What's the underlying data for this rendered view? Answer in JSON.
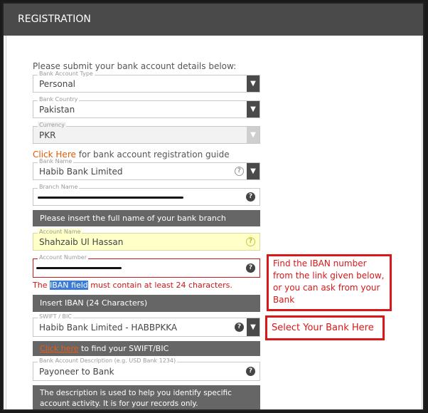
{
  "header": {
    "title": "REGISTRATION"
  },
  "intro": "Please submit your bank account details below:",
  "fields": {
    "account_type": {
      "label": "Bank Account Type",
      "value": "Personal"
    },
    "bank_country": {
      "label": "Bank Country",
      "value": "Pakistan"
    },
    "currency": {
      "label": "Currency",
      "value": "PKR"
    },
    "bank_name": {
      "label": "Bank Name",
      "value": "Habib Bank Limited"
    },
    "branch_name": {
      "label": "Branch Name",
      "value": ""
    },
    "account_name": {
      "label": "Account Name",
      "value": "Shahzaib Ul Hassan"
    },
    "account_number": {
      "label": "Account Number",
      "value": ""
    },
    "swift": {
      "label": "SWIFT / BIC",
      "value": "Habib Bank Limited - HABBPKKA"
    },
    "description": {
      "label": "Bank Account Description (e.g. USD Bank 1234)",
      "value": "Payoneer to Bank"
    }
  },
  "guide": {
    "link": "Click Here",
    "text": " for bank account registration guide"
  },
  "branch_hint": "Please insert the full name of your bank branch",
  "iban_error": {
    "prefix": "The ",
    "highlight": "IBAN field",
    "suffix": " must contain at least 24 characters."
  },
  "iban_bar": "Insert IBAN (24 Characters)",
  "swift_bar": {
    "link": "Click here",
    "text": " to find your SWIFT/BIC"
  },
  "description_hint": "The description is used to help you identify specific account activity. It is for your records only.",
  "annotations": {
    "iban_note": "Find the IBAN number from the link given below, or you can ask from your Bank",
    "bank_note": "Select Your Bank Here"
  },
  "icons": {
    "help": "?",
    "dropdown": "▼"
  },
  "colors": {
    "header_bg": "#4a4a4a",
    "link": "#e05a00",
    "error": "#c81818",
    "annotation": "#d81818",
    "highlight_field": "#ffffc8"
  }
}
